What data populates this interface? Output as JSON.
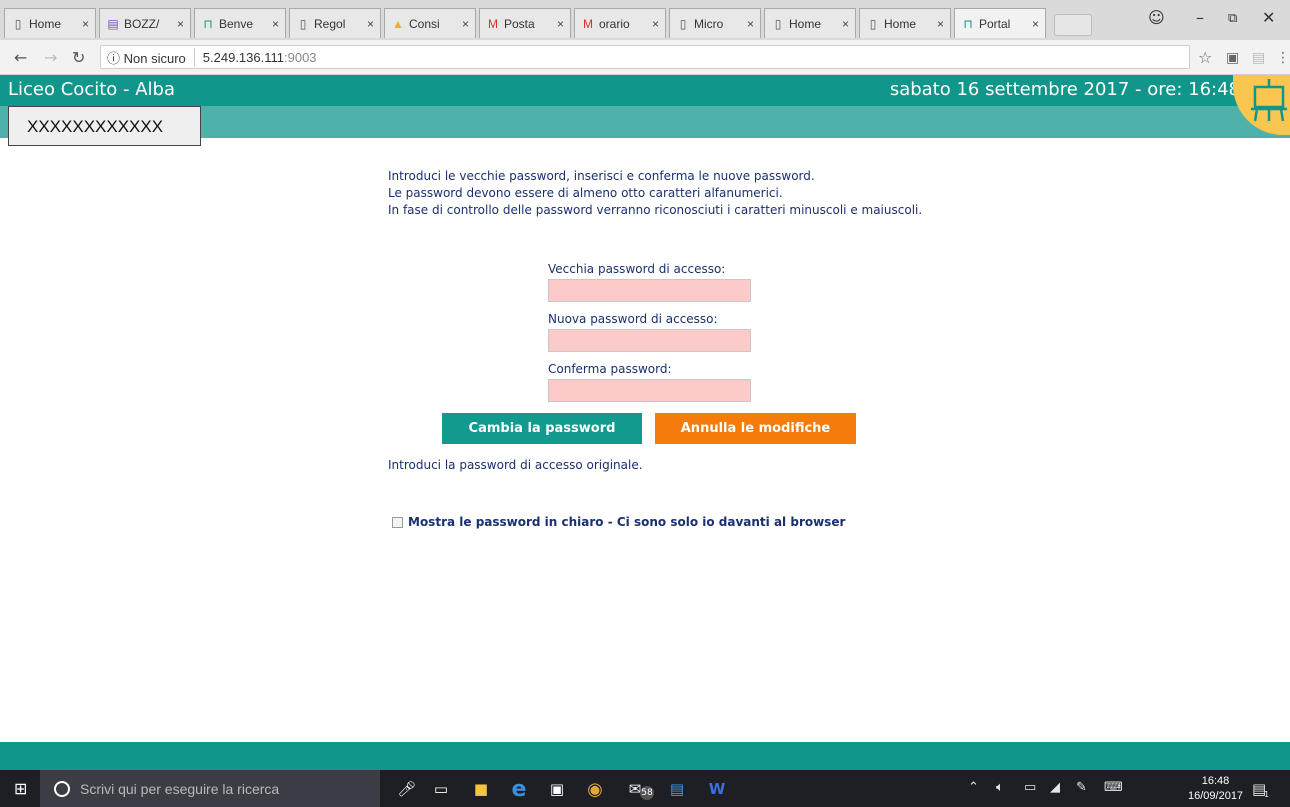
{
  "browser": {
    "tabs": [
      {
        "label": "Home",
        "icon": "page-icon"
      },
      {
        "label": "BOZZ/",
        "icon": "forms-icon"
      },
      {
        "label": "Benve",
        "icon": "easel-icon"
      },
      {
        "label": "Regol",
        "icon": "page-icon"
      },
      {
        "label": "Consi",
        "icon": "drive-icon"
      },
      {
        "label": "Posta",
        "icon": "gmail-icon"
      },
      {
        "label": "orario",
        "icon": "gmail-icon"
      },
      {
        "label": "Micro",
        "icon": "page-icon"
      },
      {
        "label": "Home",
        "icon": "page-icon"
      },
      {
        "label": "Home",
        "icon": "page-icon"
      },
      {
        "label": "Portal",
        "icon": "easel-icon"
      }
    ],
    "close_glyph": "×",
    "security_label": "Non sicuro",
    "url_host": "5.249.136.111",
    "url_port": ":9003"
  },
  "header": {
    "school_name": "Liceo Cocito - Alba",
    "date_text": "sabato 16 settembre 2017 - ore: 16:48",
    "user_name": "XXXXXXXXXXXX",
    "colors": {
      "primary": "#10968a",
      "secondary": "#4fb2aa",
      "logo_bg": "#f9c74f"
    }
  },
  "form": {
    "intro_lines": [
      "Introduci le vecchie password, inserisci e conferma le nuove password.",
      "Le password devono essere di almeno otto caratteri alfanumerici.",
      "In fase di controllo delle password verranno riconosciuti i caratteri minuscoli e maiuscoli."
    ],
    "old_password_label": "Vecchia password di accesso:",
    "new_password_label": "Nuova password di accesso:",
    "confirm_password_label": "Conferma password:",
    "submit_label": "Cambia la password",
    "cancel_label": "Annulla le modifiche",
    "hint_text": "Introduci la password di accesso originale.",
    "show_password_label": "Mostra le password in chiaro - Ci sono solo io davanti al browser",
    "colors": {
      "submit": "#129a8e",
      "cancel": "#f57c0a",
      "field_bg": "#fdcaca",
      "text": "#1a3070"
    }
  },
  "taskbar": {
    "search_placeholder": "Scrivi qui per eseguire la ricerca",
    "mail_badge": "58",
    "time": "16:48",
    "date": "16/09/2017",
    "notification_count": "1"
  }
}
